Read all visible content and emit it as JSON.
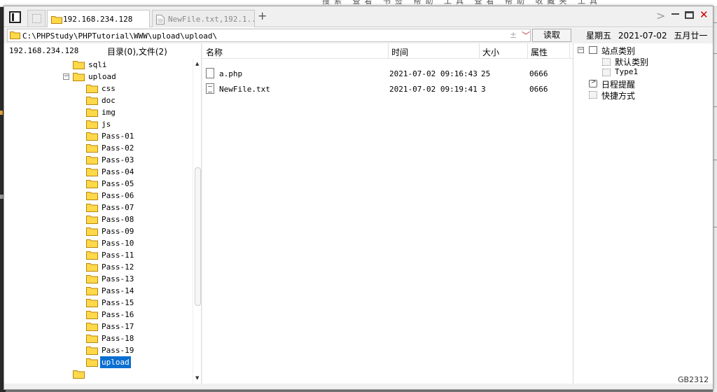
{
  "background": {
    "menu_fragments": "搜索 查看 书签 帮助 工具 查看 帮助 收藏夹 工具"
  },
  "tabs": [
    {
      "label": "192.168.234.128",
      "active": true
    },
    {
      "label": "NewFile.txt,192.1...",
      "active": false
    }
  ],
  "address": {
    "path": "C:\\PHPStudy\\PHPTutorial\\WWW\\upload\\upload\\",
    "read_button": "读取"
  },
  "date_info": {
    "weekday": "星期五",
    "date": "2021-07-02",
    "lunar": "五月廿一"
  },
  "left_panel": {
    "ip": "192.168.234.128",
    "summary": "目录(0),文件(2)"
  },
  "tree": [
    {
      "label": "sqli",
      "level": 1,
      "selected": false
    },
    {
      "label": "upload",
      "level": 1,
      "expanded": true,
      "selected": false
    },
    {
      "label": "css",
      "level": 2,
      "selected": false
    },
    {
      "label": "doc",
      "level": 2,
      "selected": false
    },
    {
      "label": "img",
      "level": 2,
      "selected": false
    },
    {
      "label": "js",
      "level": 2,
      "selected": false
    },
    {
      "label": "Pass-01",
      "level": 2,
      "selected": false
    },
    {
      "label": "Pass-02",
      "level": 2,
      "selected": false
    },
    {
      "label": "Pass-03",
      "level": 2,
      "selected": false
    },
    {
      "label": "Pass-04",
      "level": 2,
      "selected": false
    },
    {
      "label": "Pass-05",
      "level": 2,
      "selected": false
    },
    {
      "label": "Pass-06",
      "level": 2,
      "selected": false
    },
    {
      "label": "Pass-07",
      "level": 2,
      "selected": false
    },
    {
      "label": "Pass-08",
      "level": 2,
      "selected": false
    },
    {
      "label": "Pass-09",
      "level": 2,
      "selected": false
    },
    {
      "label": "Pass-10",
      "level": 2,
      "selected": false
    },
    {
      "label": "Pass-11",
      "level": 2,
      "selected": false
    },
    {
      "label": "Pass-12",
      "level": 2,
      "selected": false
    },
    {
      "label": "Pass-13",
      "level": 2,
      "selected": false
    },
    {
      "label": "Pass-14",
      "level": 2,
      "selected": false
    },
    {
      "label": "Pass-15",
      "level": 2,
      "selected": false
    },
    {
      "label": "Pass-16",
      "level": 2,
      "selected": false
    },
    {
      "label": "Pass-17",
      "level": 2,
      "selected": false
    },
    {
      "label": "Pass-18",
      "level": 2,
      "selected": false
    },
    {
      "label": "Pass-19",
      "level": 2,
      "selected": false
    },
    {
      "label": "upload",
      "level": 2,
      "selected": true
    }
  ],
  "file_list": {
    "columns": [
      "名称",
      "时间",
      "大小",
      "属性"
    ],
    "rows": [
      {
        "name": "a.php",
        "time": "2021-07-02 09:16:43",
        "size": "25",
        "attr": "0666",
        "icon": "php-file-icon"
      },
      {
        "name": "NewFile.txt",
        "time": "2021-07-02 09:19:41",
        "size": "3",
        "attr": "0666",
        "icon": "text-file-icon"
      }
    ]
  },
  "right_panel": {
    "site_category": "站点类别",
    "default_category": "默认类别",
    "type1": "Type1",
    "schedule": "日程提醒",
    "shortcuts": "快捷方式"
  },
  "status": {
    "encoding": "GB2312"
  },
  "colors": {
    "selection": "#0a6fd1",
    "folder_fill": "#ffd94a",
    "close_red": "#d00000"
  }
}
